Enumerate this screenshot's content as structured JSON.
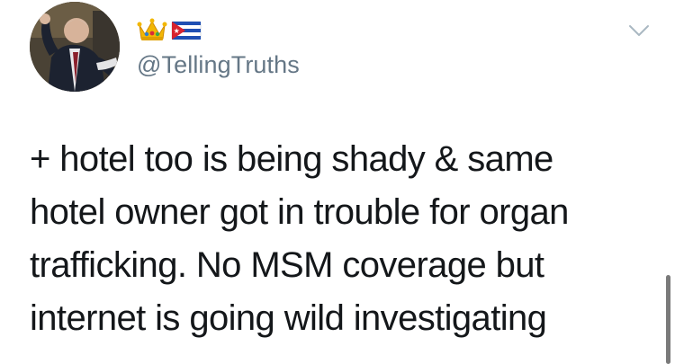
{
  "tweet": {
    "author": {
      "display_name_emojis": [
        "crown-emoji",
        "cuba-flag-emoji"
      ],
      "handle": "@TellingTruths"
    },
    "menu_icon": "chevron-down-icon",
    "text": "+ hotel too is being shady & same\nhotel owner got in trouble for organ\ntrafficking. No MSM coverage but\ninternet is going wild investigating"
  },
  "colors": {
    "text": "#14171a",
    "secondary_text": "#657786",
    "caret": "#aab8c2",
    "background": "#ffffff"
  }
}
